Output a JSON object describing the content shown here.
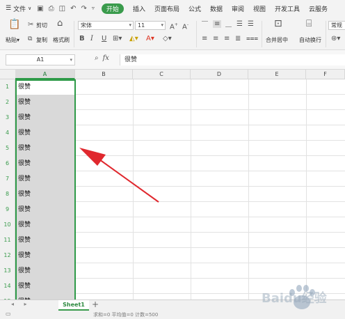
{
  "menu": {
    "file": "文件",
    "tabs": [
      "开始",
      "插入",
      "页面布局",
      "公式",
      "数据",
      "审阅",
      "视图",
      "开发工具",
      "云服务"
    ]
  },
  "ribbon": {
    "paste": "粘贴",
    "cut": "剪切",
    "copy": "复制",
    "format_painter": "格式刷",
    "font_name": "宋体",
    "font_size": "11",
    "bold": "B",
    "italic": "I",
    "underline": "U",
    "grow_font": "A⁺",
    "shrink_font": "A⁻",
    "merge_center": "合并居中",
    "wrap_text": "自动换行",
    "normal": "常规"
  },
  "formula_bar": {
    "name_box": "A1",
    "fx": "fx",
    "value": "很赞"
  },
  "grid": {
    "columns": [
      "A",
      "B",
      "C",
      "D",
      "E",
      "F"
    ],
    "rows": [
      {
        "num": "1",
        "a": "很赞"
      },
      {
        "num": "2",
        "a": "很赞"
      },
      {
        "num": "3",
        "a": "很赞"
      },
      {
        "num": "4",
        "a": "很赞"
      },
      {
        "num": "5",
        "a": "很赞"
      },
      {
        "num": "6",
        "a": "很赞"
      },
      {
        "num": "7",
        "a": "很赞"
      },
      {
        "num": "8",
        "a": "很赞"
      },
      {
        "num": "9",
        "a": "很赞"
      },
      {
        "num": "10",
        "a": "很赞"
      },
      {
        "num": "11",
        "a": "很赞"
      },
      {
        "num": "12",
        "a": "很赞"
      },
      {
        "num": "13",
        "a": "很赞"
      },
      {
        "num": "14",
        "a": "很赞"
      },
      {
        "num": "15",
        "a": "很赞"
      }
    ]
  },
  "sheets": {
    "active": "Sheet1",
    "add": "+"
  },
  "status": {
    "text": "求和=0  平均值=0  计数=500"
  },
  "watermark": {
    "text": "Baidu经验"
  },
  "colors": {
    "accent": "#3a9b4c",
    "arrow": "#e0282e"
  }
}
